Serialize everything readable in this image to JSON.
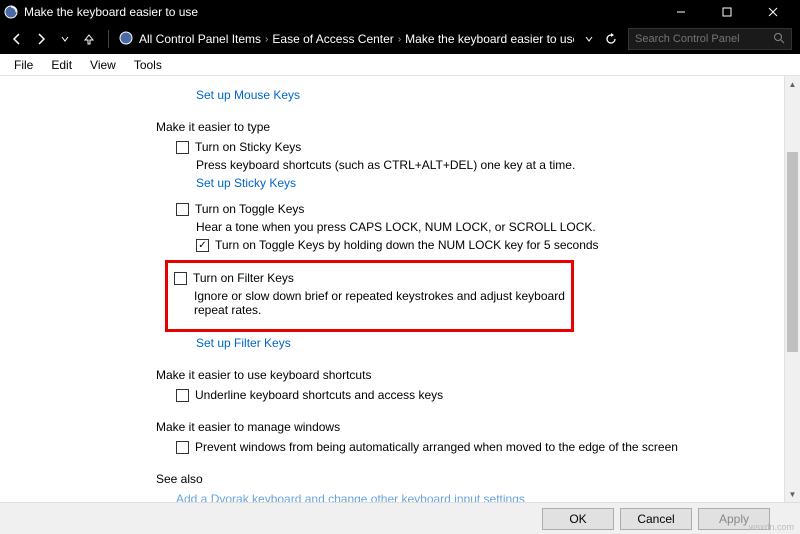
{
  "titlebar": {
    "title": "Make the keyboard easier to use"
  },
  "breadcrumb": {
    "items": [
      "All Control Panel Items",
      "Ease of Access Center",
      "Make the keyboard easier to use"
    ]
  },
  "search": {
    "placeholder": "Search Control Panel"
  },
  "menubar": [
    "File",
    "Edit",
    "View",
    "Tools"
  ],
  "top_link": "Set up Mouse Keys",
  "section_type": {
    "heading": "Make it easier to type",
    "sticky": {
      "label": "Turn on Sticky Keys",
      "desc": "Press keyboard shortcuts (such as CTRL+ALT+DEL) one key at a time.",
      "link": "Set up Sticky Keys"
    },
    "toggle": {
      "label": "Turn on Toggle Keys",
      "desc": "Hear a tone when you press CAPS LOCK, NUM LOCK, or SCROLL LOCK.",
      "hold_label": "Turn on Toggle Keys by holding down the NUM LOCK key for 5 seconds"
    },
    "filter": {
      "label": "Turn on Filter Keys",
      "desc": "Ignore or slow down brief or repeated keystrokes and adjust keyboard repeat rates.",
      "link": "Set up Filter Keys"
    }
  },
  "section_shortcuts": {
    "heading": "Make it easier to use keyboard shortcuts",
    "underline_label": "Underline keyboard shortcuts and access keys"
  },
  "section_windows": {
    "heading": "Make it easier to manage windows",
    "prevent_label": "Prevent windows from being automatically arranged when moved to the edge of the screen"
  },
  "see_also": {
    "heading": "See also",
    "link": "Add a Dvorak keyboard and change other keyboard input settings"
  },
  "footer": {
    "ok": "OK",
    "cancel": "Cancel",
    "apply": "Apply"
  },
  "watermark": "wsxdn.com"
}
